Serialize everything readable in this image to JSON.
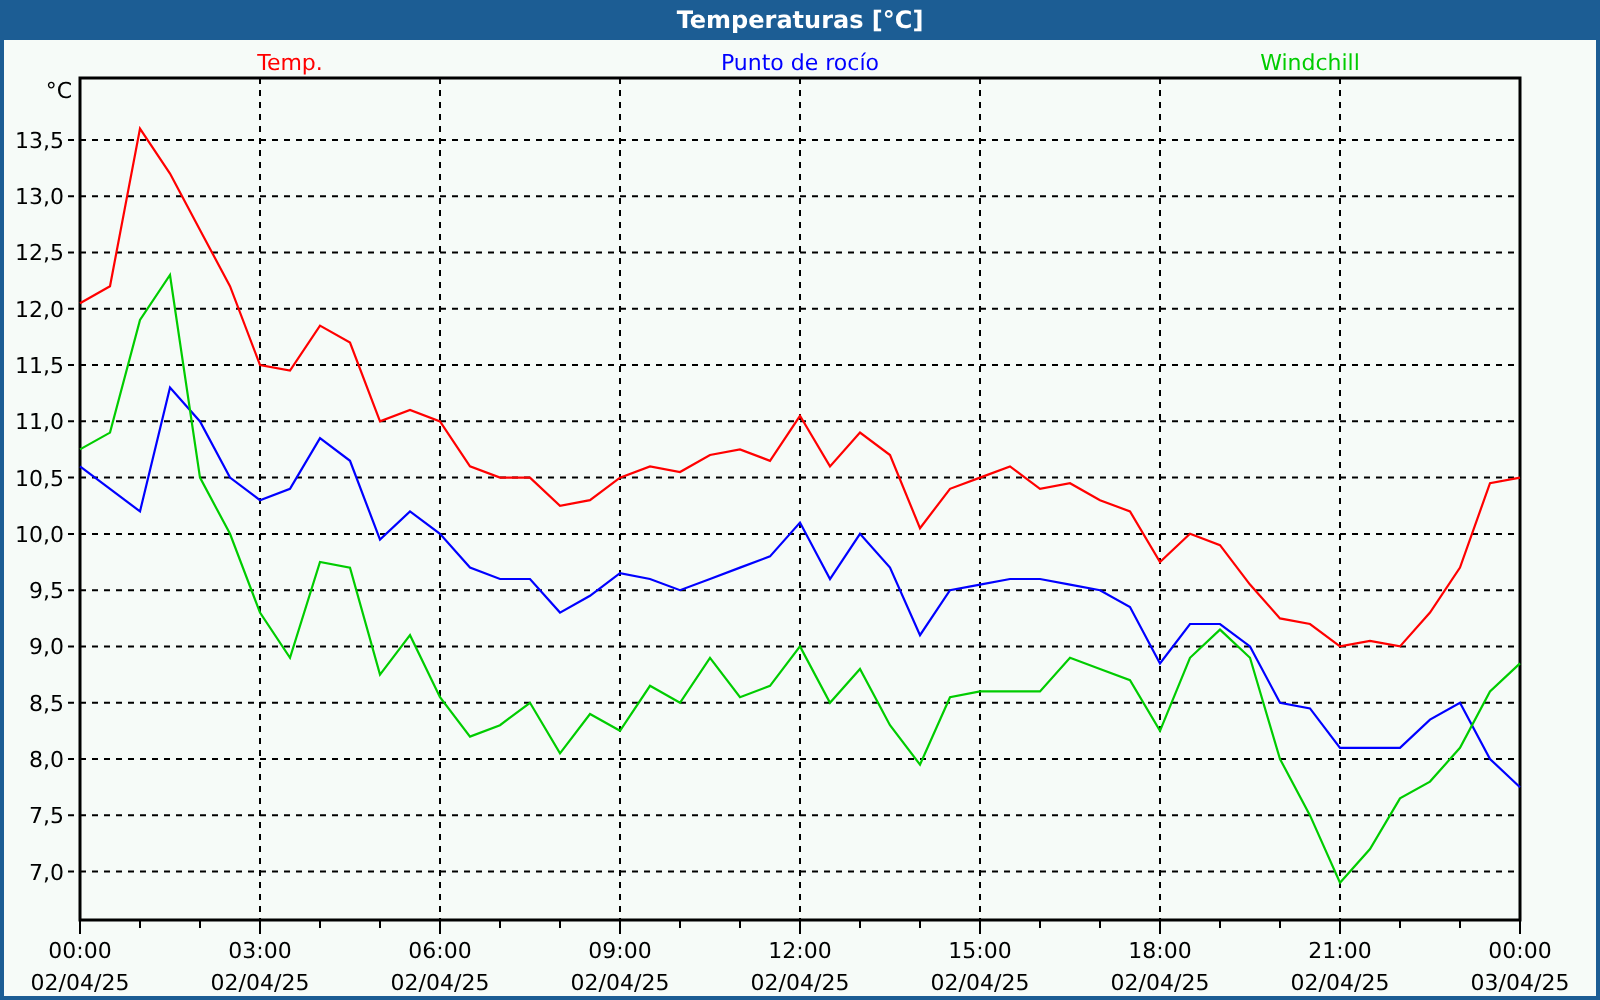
{
  "window": {
    "title": "Temperaturas [°C]"
  },
  "chart": {
    "chart_data": {
      "type": "line",
      "ylabel": "°C",
      "categories": [
        "00:00 02/04/25",
        null,
        null,
        null,
        null,
        null,
        "03:00 02/04/25",
        null,
        null,
        null,
        null,
        null,
        "06:00 02/04/25",
        null,
        null,
        null,
        null,
        null,
        "09:00 02/04/25",
        null,
        null,
        null,
        null,
        null,
        "12:00 02/04/25",
        null,
        null,
        null,
        null,
        null,
        "15:00 02/04/25",
        null,
        null,
        null,
        null,
        null,
        "18:00 02/04/25",
        null,
        null,
        null,
        null,
        null,
        "21:00 02/04/25",
        null,
        null,
        null,
        null,
        null,
        "00:00 03/04/25"
      ],
      "series": [
        {
          "name": "Temp.",
          "color": "#ff0000",
          "values": [
            12.05,
            12.2,
            13.6,
            13.2,
            12.7,
            12.2,
            11.5,
            11.45,
            11.85,
            11.7,
            11.0,
            11.1,
            11.0,
            10.6,
            10.5,
            10.5,
            10.25,
            10.3,
            10.5,
            10.6,
            10.55,
            10.7,
            10.75,
            10.65,
            11.05,
            10.6,
            10.9,
            10.7,
            10.05,
            10.4,
            10.5,
            10.6,
            10.4,
            10.45,
            10.3,
            10.2,
            9.75,
            10.0,
            9.9,
            9.55,
            9.25,
            9.2,
            9.0,
            9.05,
            9.0,
            9.3,
            9.7,
            10.45,
            10.5
          ]
        },
        {
          "name": "Punto de rocío",
          "color": "#0000ff",
          "values": [
            10.6,
            10.4,
            10.2,
            11.3,
            11.0,
            10.5,
            10.3,
            10.4,
            10.85,
            10.65,
            9.95,
            10.2,
            10.0,
            9.7,
            9.6,
            9.6,
            9.3,
            9.45,
            9.65,
            9.6,
            9.5,
            9.6,
            9.7,
            9.8,
            10.1,
            9.6,
            10.0,
            9.7,
            9.1,
            9.5,
            9.55,
            9.6,
            9.6,
            9.55,
            9.5,
            9.35,
            8.85,
            9.2,
            9.2,
            9.0,
            8.5,
            8.45,
            8.1,
            8.1,
            8.1,
            8.35,
            8.5,
            8.0,
            7.75
          ]
        },
        {
          "name": "Windchill",
          "color": "#00cc00",
          "values": [
            10.75,
            10.9,
            11.9,
            12.3,
            10.5,
            10.0,
            9.3,
            8.9,
            9.75,
            9.7,
            8.75,
            9.1,
            8.55,
            8.2,
            8.3,
            8.5,
            8.05,
            8.4,
            8.25,
            8.65,
            8.5,
            8.9,
            8.55,
            8.65,
            9.0,
            8.5,
            8.8,
            8.3,
            7.95,
            8.55,
            8.6,
            8.6,
            8.6,
            8.9,
            8.8,
            8.7,
            8.25,
            8.9,
            9.15,
            8.9,
            8.0,
            7.5,
            6.9,
            7.2,
            7.65,
            7.8,
            8.1,
            8.6,
            8.85
          ]
        }
      ],
      "ylim": [
        6.57,
        14.05
      ],
      "grid": true,
      "yticks": [
        {
          "value": 7,
          "label": "7,0"
        },
        {
          "value": 7.5,
          "label": "7,5"
        },
        {
          "value": 8,
          "label": "8,0"
        },
        {
          "value": 8.5,
          "label": "8,5"
        },
        {
          "value": 9,
          "label": "9,0"
        },
        {
          "value": 9.5,
          "label": "9,5"
        },
        {
          "value": 10,
          "label": "10,0"
        },
        {
          "value": 10.5,
          "label": "10,5"
        },
        {
          "value": 11,
          "label": "11,0"
        },
        {
          "value": 11.5,
          "label": "11,5"
        },
        {
          "value": 12,
          "label": "12,0"
        },
        {
          "value": 12.5,
          "label": "12,5"
        },
        {
          "value": 13,
          "label": "13,0"
        },
        {
          "value": 13.5,
          "label": "13,5"
        }
      ]
    }
  }
}
